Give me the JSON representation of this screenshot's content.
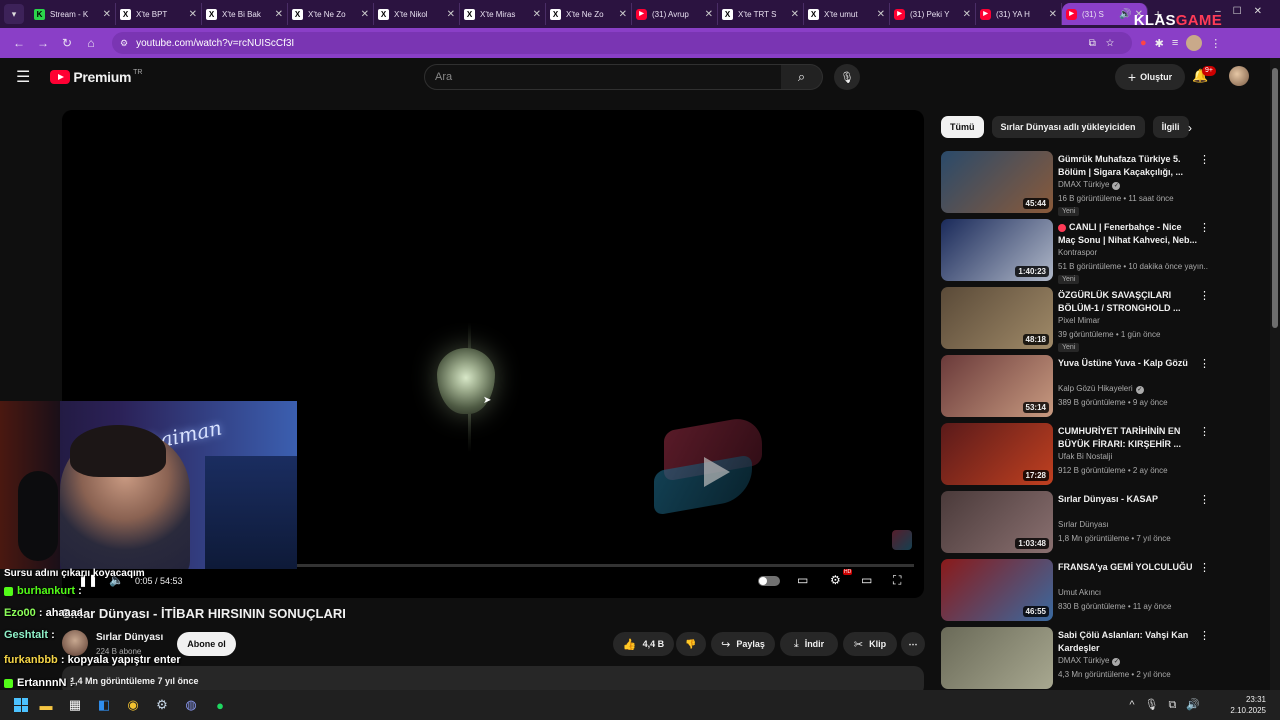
{
  "browser": {
    "tabs": [
      {
        "label": "Stream - K",
        "icon": "stream-icon"
      },
      {
        "label": "X'te BPT",
        "icon": "x-icon"
      },
      {
        "label": "X'te Bi Bak",
        "icon": "x-icon"
      },
      {
        "label": "X'te Ne Zo",
        "icon": "x-icon"
      },
      {
        "label": "X'te Nikol",
        "icon": "x-icon"
      },
      {
        "label": "X'te Miras",
        "icon": "x-icon"
      },
      {
        "label": "X'te Ne Zo",
        "icon": "x-icon"
      },
      {
        "label": "(31) Avrup",
        "icon": "youtube-icon"
      },
      {
        "label": "X'te TRT S",
        "icon": "x-icon"
      },
      {
        "label": "X'te umut",
        "icon": "x-icon"
      },
      {
        "label": "(31) Peki Y",
        "icon": "youtube-icon"
      },
      {
        "label": "(31) YA H",
        "icon": "youtube-icon"
      },
      {
        "label": "(31) S",
        "icon": "youtube-icon",
        "active": true
      }
    ],
    "url": "youtube.com/watch?v=rcNUIScCf3I",
    "watermark": {
      "part1": "KLAS",
      "part2": "GAME"
    }
  },
  "masthead": {
    "brand": "Premium",
    "region": "TR",
    "search_placeholder": "Ara",
    "create_label": "Oluştur",
    "notif_badge": "9+"
  },
  "player": {
    "time": "0:05 / 54:53",
    "progress_fraction": 0.0015
  },
  "video": {
    "title": "Sırlar Dünyası - İTİBAR HIRSININ SONUÇLARI",
    "channel": "Sırlar Dünyası",
    "subscribers": "224 B abone",
    "subscribe_label": "Abone ol",
    "likes": "4,4 B",
    "share_label": "Paylaş",
    "download_label": "İndir",
    "clip_label": "Klip",
    "views_meta": "1,4 Mn görüntüleme  7 yıl önce"
  },
  "chat": {
    "partial_top": "Sursu adını çıkarıı koyacaqım",
    "messages": [
      {
        "user": "burhankurt",
        "text": ":",
        "color": "green",
        "badge": true
      },
      {
        "user": "Ezo00",
        "text": ": ahaaaa",
        "color": "lime",
        "badge": false
      },
      {
        "user": "Geshtalt",
        "text": ":",
        "color": "aqua",
        "badge": false
      },
      {
        "user": "furkanbbb",
        "text": ": kopyala yapıştır enter",
        "color": "yellow",
        "badge": false
      },
      {
        "user": "ErtannnN",
        "text": ":",
        "color": "white",
        "badge": true
      }
    ]
  },
  "sidebar": {
    "chips": [
      "Tümü",
      "Sırlar Dünyası adlı yükleyiciden",
      "İlgili"
    ],
    "recommendations": [
      {
        "title": "Gümrük Muhafaza Türkiye 5. Bölüm | Sigara Kaçakçılığı, ...",
        "channel": "DMAX Türkiye",
        "verified": true,
        "meta": "16 B görüntüleme • 11 saat önce",
        "duration": "45:44",
        "new": "Yeni",
        "colors": [
          "#2a4a6a",
          "#8a5a3a"
        ]
      },
      {
        "title": "CANLI | Fenerbahçe - Nice Maç Sonu | Nihat Kahveci, Neb...",
        "channel": "Kontraspor",
        "verified": false,
        "meta": "51 B görüntüleme • 10 dakika önce yayın...",
        "duration": "1:40:23",
        "new": "Yeni",
        "live": true,
        "colors": [
          "#1a2a5a",
          "#b0b8c8"
        ]
      },
      {
        "title": "ÖZGÜRLÜK SAVAŞÇILARI BÖLÜM-1 / STRONGHOLD ...",
        "channel": "Pixel Mimar",
        "verified": false,
        "meta": "39 görüntüleme • 1 gün önce",
        "duration": "48:18",
        "new": "Yeni",
        "colors": [
          "#5a4a38",
          "#a08a68"
        ]
      },
      {
        "title": "Yuva Üstüne Yuva - Kalp Gözü",
        "channel": "Kalp Gözü Hikayeleri",
        "verified": true,
        "meta": "389 B görüntüleme • 9 ay önce",
        "duration": "53:14",
        "colors": [
          "#6a3a3a",
          "#c89a80"
        ]
      },
      {
        "title": "CUMHURİYET TARİHİNİN EN BÜYÜK FİRARI: KIRŞEHİR ...",
        "channel": "Ufak Bi Nostalji",
        "verified": false,
        "meta": "912 B görüntüleme • 2 ay önce",
        "duration": "17:28",
        "colors": [
          "#5a1a1a",
          "#c04020"
        ]
      },
      {
        "title": "Sırlar Dünyası - KASAP",
        "channel": "Sırlar Dünyası",
        "verified": false,
        "meta": "1,8 Mn görüntüleme • 7 yıl önce",
        "duration": "1:03:48",
        "colors": [
          "#4a3a3a",
          "#8a7070"
        ]
      },
      {
        "title": "FRANSA'ya GEMİ YOLCULUĞU",
        "channel": "Umut Akıncı",
        "verified": false,
        "meta": "830 B görüntüleme • 11 ay önce",
        "duration": "46:55",
        "colors": [
          "#8a1a1a",
          "#3a6aa0"
        ]
      },
      {
        "title": "Sabi Çölü Aslanları: Vahşi Kan Kardeşler",
        "channel": "DMAX Türkiye",
        "verified": true,
        "meta": "4,3 Mn görüntüleme • 2 yıl önce",
        "duration": "",
        "colors": [
          "#6a6a58",
          "#a8a890"
        ]
      }
    ]
  },
  "taskbar": {
    "time": "23:31",
    "date": "2.10.2025"
  }
}
